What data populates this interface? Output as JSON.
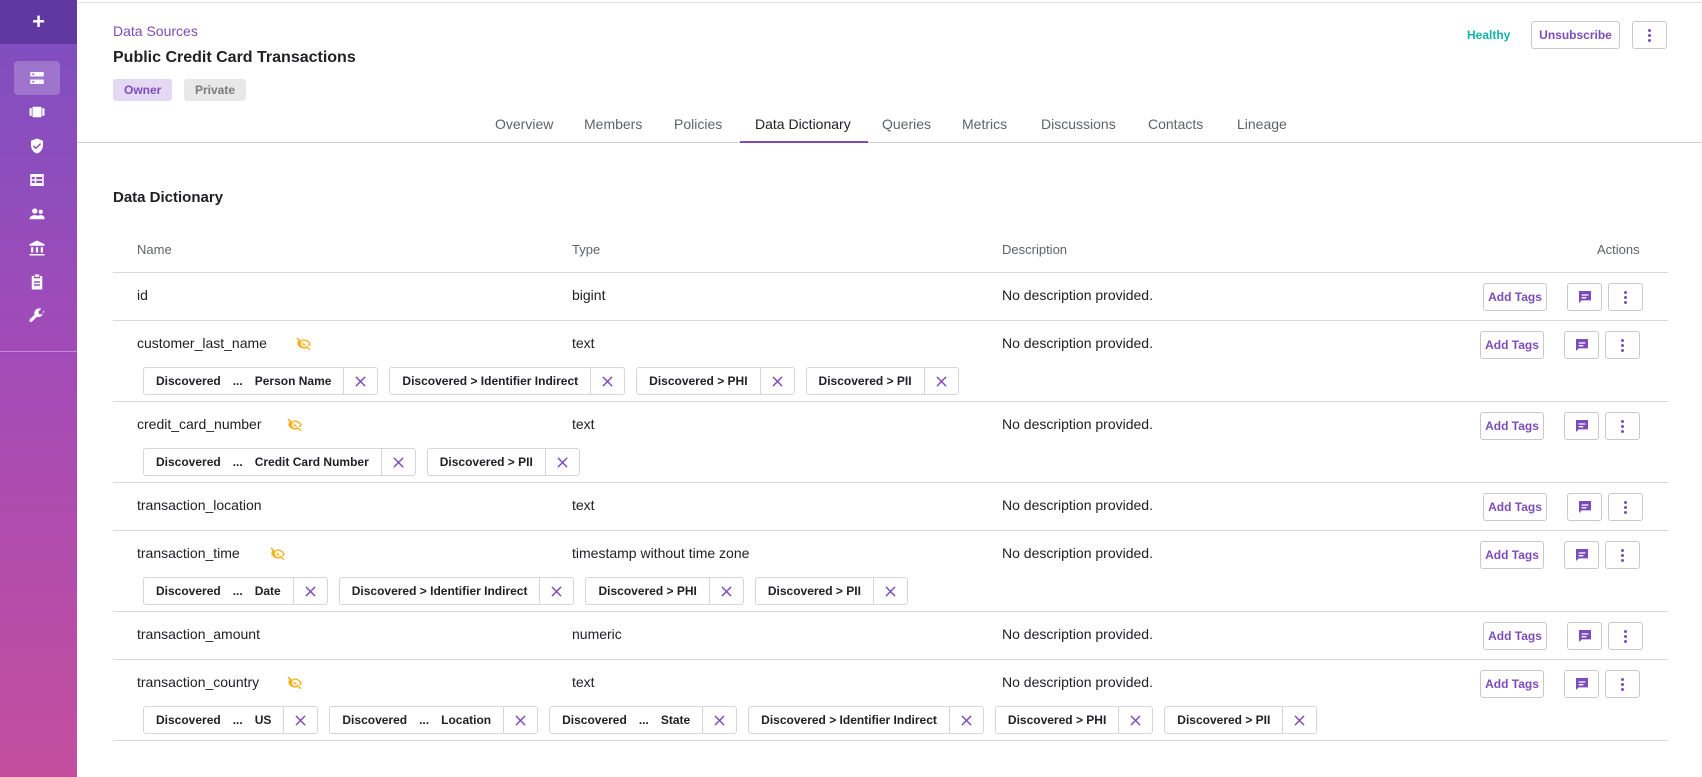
{
  "sidebar": {
    "add_label": "+",
    "items": [
      {
        "name": "data-sources",
        "icon": "database-icon",
        "active": true
      },
      {
        "name": "projects",
        "icon": "projects-icon",
        "active": false
      },
      {
        "name": "policies",
        "icon": "shield-check-icon",
        "active": false
      },
      {
        "name": "queries",
        "icon": "table-icon",
        "active": false
      },
      {
        "name": "people",
        "icon": "people-icon",
        "active": false
      },
      {
        "name": "governance",
        "icon": "bank-icon",
        "active": false
      },
      {
        "name": "audit",
        "icon": "clipboard-icon",
        "active": false
      },
      {
        "name": "settings",
        "icon": "wrench-icon",
        "active": false
      }
    ]
  },
  "header": {
    "breadcrumb": "Data Sources",
    "title": "Public Credit Card Transactions",
    "badges": [
      "Owner",
      "Private"
    ],
    "health": "Healthy",
    "unsubscribe_label": "Unsubscribe",
    "colors": {
      "accent": "#7c4dba",
      "health": "#12b5a5",
      "warning": "#f5b21a"
    }
  },
  "tabs": [
    "Overview",
    "Members",
    "Policies",
    "Data Dictionary",
    "Queries",
    "Metrics",
    "Discussions",
    "Contacts",
    "Lineage"
  ],
  "active_tab": "Data Dictionary",
  "section_title": "Data Dictionary",
  "table": {
    "columns": [
      "Name",
      "Type",
      "Description",
      "Actions"
    ],
    "add_tags_label": "Add Tags",
    "rows": [
      {
        "name": "id",
        "type": "bigint",
        "description": "No description provided.",
        "masked": false,
        "tags": []
      },
      {
        "name": "customer_last_name",
        "type": "text",
        "description": "No description provided.",
        "masked": true,
        "tags": [
          {
            "prefix": "Discovered",
            "ellipsis": "...",
            "suffix": "Person Name"
          },
          {
            "text": "Discovered > Identifier Indirect"
          },
          {
            "text": "Discovered > PHI"
          },
          {
            "text": "Discovered > PII"
          }
        ]
      },
      {
        "name": "credit_card_number",
        "type": "text",
        "description": "No description provided.",
        "masked": true,
        "tags": [
          {
            "prefix": "Discovered",
            "ellipsis": "...",
            "suffix": "Credit Card Number"
          },
          {
            "text": "Discovered > PII"
          }
        ]
      },
      {
        "name": "transaction_location",
        "type": "text",
        "description": "No description provided.",
        "masked": false,
        "tags": []
      },
      {
        "name": "transaction_time",
        "type": "timestamp without time zone",
        "description": "No description provided.",
        "masked": true,
        "tags": [
          {
            "prefix": "Discovered",
            "ellipsis": "...",
            "suffix": "Date"
          },
          {
            "text": "Discovered > Identifier Indirect"
          },
          {
            "text": "Discovered > PHI"
          },
          {
            "text": "Discovered > PII"
          }
        ]
      },
      {
        "name": "transaction_amount",
        "type": "numeric",
        "description": "No description provided.",
        "masked": false,
        "tags": []
      },
      {
        "name": "transaction_country",
        "type": "text",
        "description": "No description provided.",
        "masked": true,
        "tags": [
          {
            "prefix": "Discovered",
            "ellipsis": "...",
            "suffix": "US"
          },
          {
            "prefix": "Discovered",
            "ellipsis": "...",
            "suffix": "Location"
          },
          {
            "prefix": "Discovered",
            "ellipsis": "...",
            "suffix": "State"
          },
          {
            "text": "Discovered > Identifier Indirect"
          },
          {
            "text": "Discovered > PHI"
          },
          {
            "text": "Discovered > PII"
          }
        ]
      }
    ]
  }
}
